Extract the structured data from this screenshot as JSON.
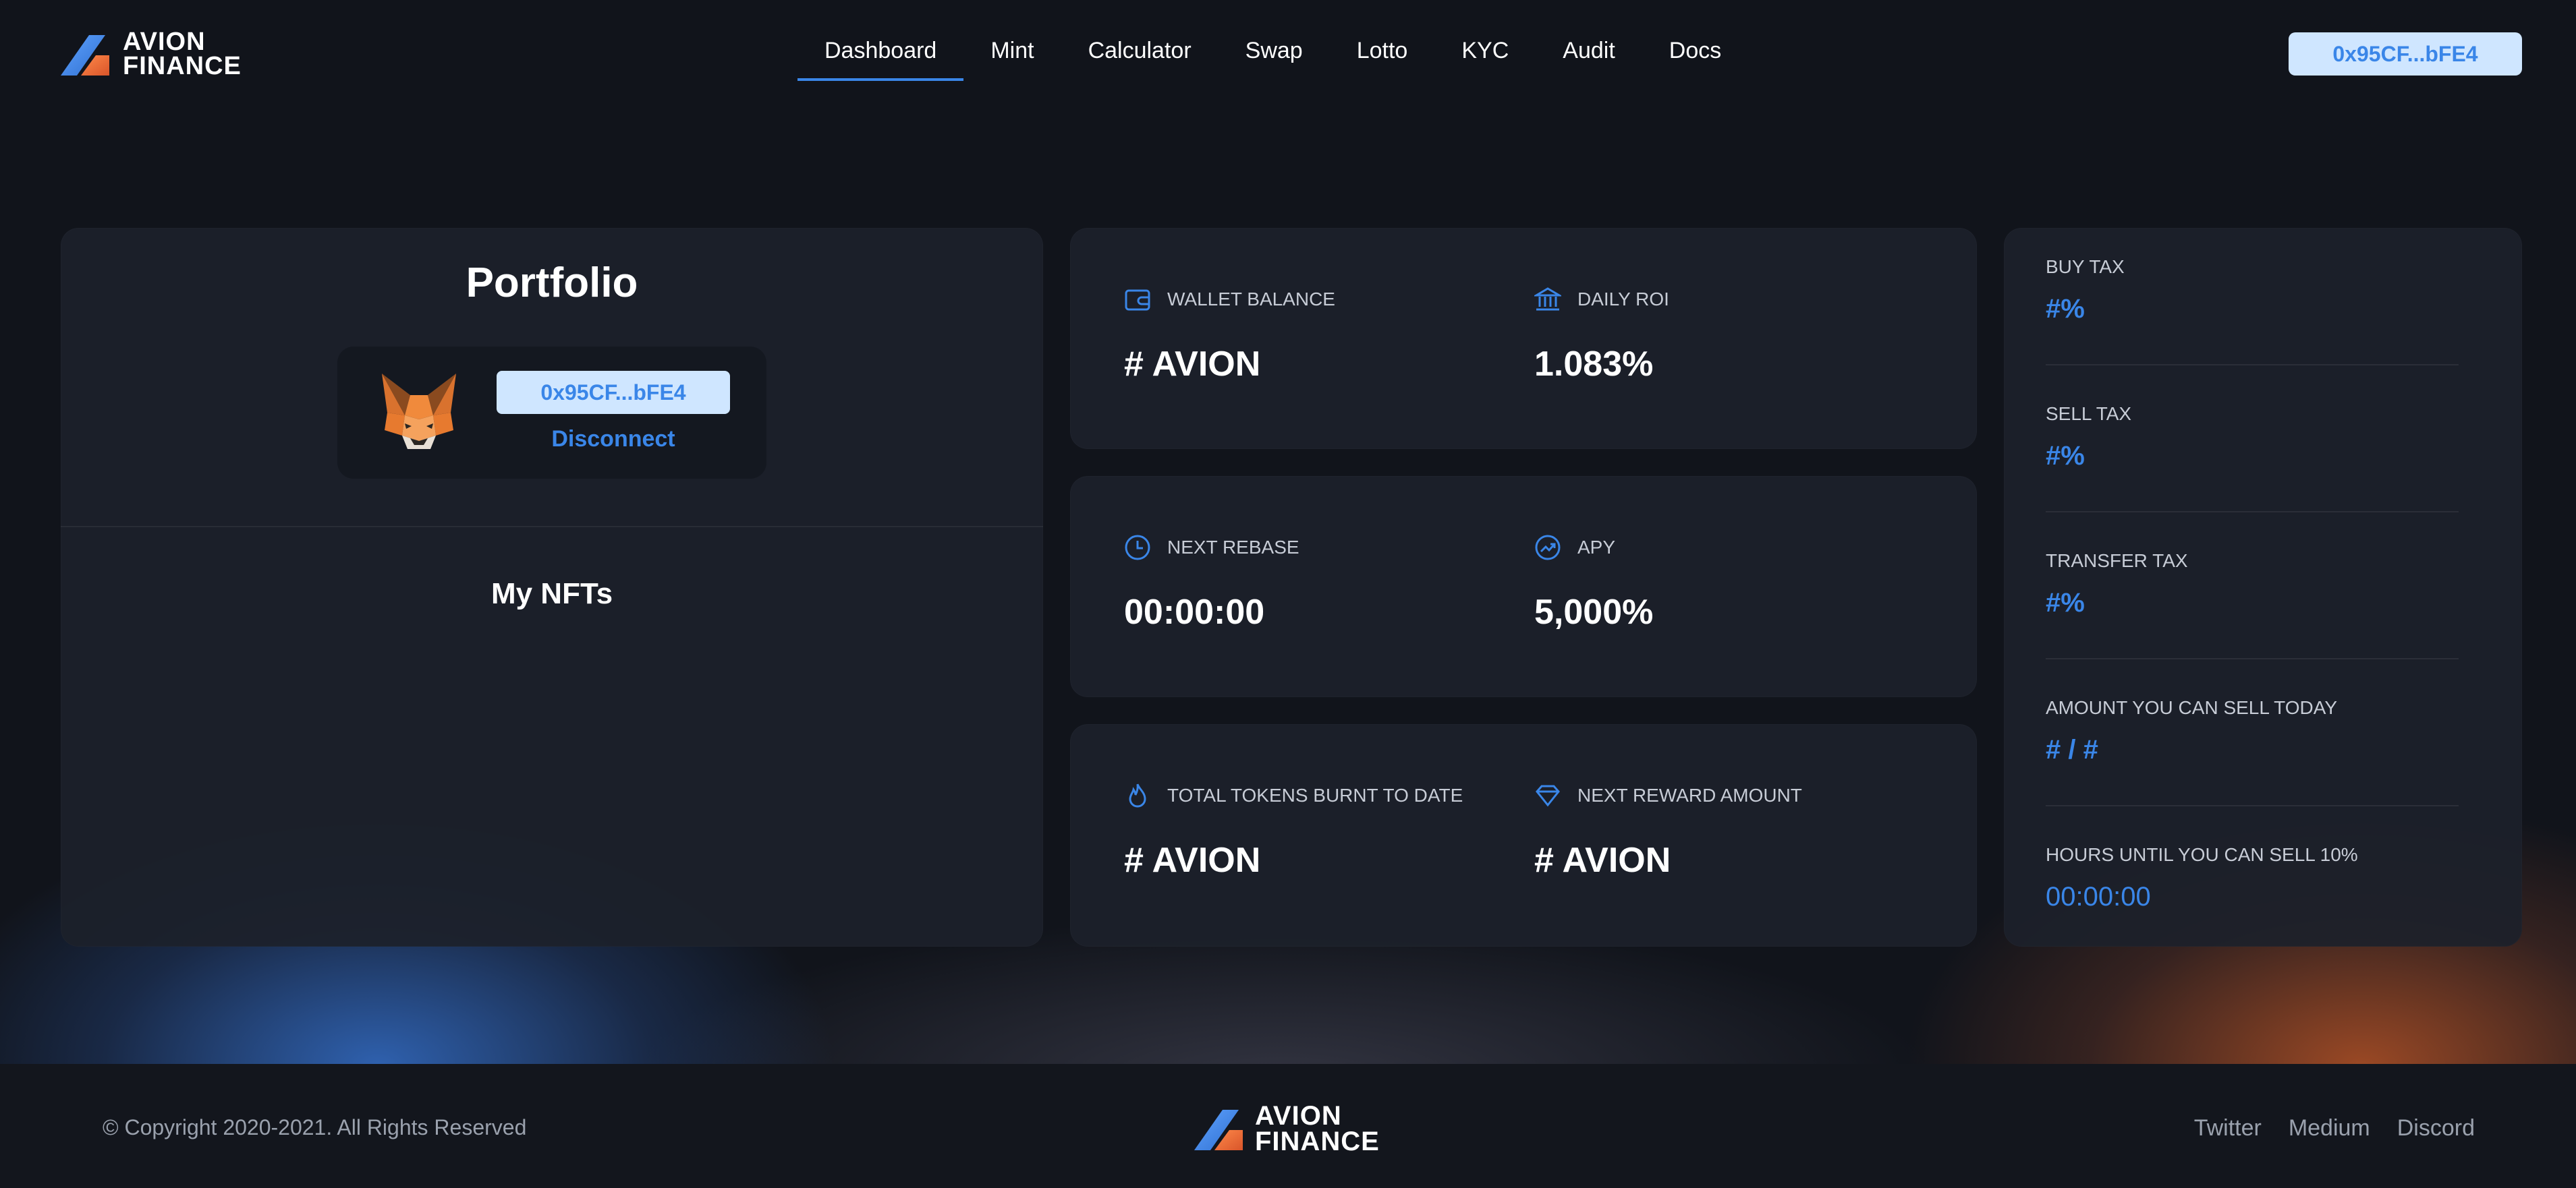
{
  "brand": {
    "line1": "AVION",
    "line2": "FINANCE"
  },
  "nav": {
    "items": [
      {
        "label": "Dashboard",
        "active": true
      },
      {
        "label": "Mint"
      },
      {
        "label": "Calculator"
      },
      {
        "label": "Swap"
      },
      {
        "label": "Lotto"
      },
      {
        "label": "KYC"
      },
      {
        "label": "Audit"
      },
      {
        "label": "Docs"
      }
    ]
  },
  "header": {
    "wallet_address": "0x95CF...bFE4"
  },
  "portfolio": {
    "title": "Portfolio",
    "wallet_address": "0x95CF...bFE4",
    "disconnect_label": "Disconnect",
    "nfts_title": "My NFTs"
  },
  "stats": {
    "wallet_balance": {
      "label": "WALLET BALANCE",
      "value": "# AVION",
      "icon": "wallet-icon"
    },
    "daily_roi": {
      "label": "DAILY ROI",
      "value": "1.083%",
      "icon": "bank-icon"
    },
    "next_rebase": {
      "label": "NEXT REBASE",
      "value": "00:00:00",
      "icon": "clock-icon"
    },
    "apy": {
      "label": "APY",
      "value": "5,000%",
      "icon": "trend-icon"
    },
    "tokens_burnt": {
      "label": "TOTAL TOKENS BURNT TO DATE",
      "value": "# AVION",
      "icon": "flame-icon"
    },
    "next_reward": {
      "label": "NEXT REWARD AMOUNT",
      "value": "# AVION",
      "icon": "diamond-icon"
    }
  },
  "taxes": {
    "buy": {
      "label": "BUY TAX",
      "value": "#%"
    },
    "sell": {
      "label": "SELL TAX",
      "value": "#%"
    },
    "transfer": {
      "label": "TRANSFER TAX",
      "value": "#%"
    },
    "sell_today": {
      "label": "AMOUNT YOU CAN SELL TODAY",
      "value": "# / #"
    },
    "hours_until": {
      "label": "HOURS UNTIL YOU CAN SELL 10%",
      "value": "00:00:00"
    }
  },
  "footer": {
    "copyright": "© Copyright 2020-2021. All Rights Reserved",
    "links": [
      "Twitter",
      "Medium",
      "Discord"
    ]
  },
  "colors": {
    "accent": "#3a86e8",
    "chip_bg": "#cfe6ff",
    "card_bg": "#1c212a",
    "page_bg": "#0f1218"
  }
}
